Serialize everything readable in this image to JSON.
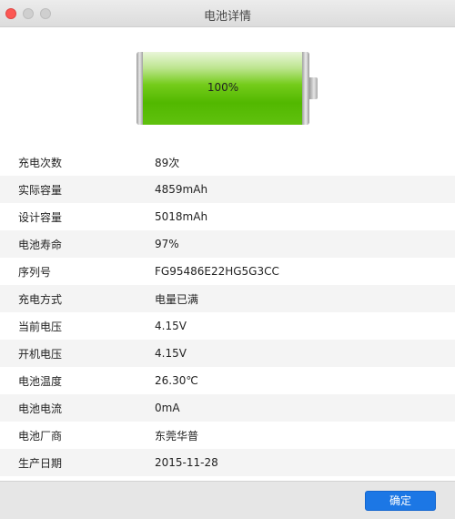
{
  "window": {
    "title": "电池详情"
  },
  "battery": {
    "percent_text": "100%",
    "charge_fraction": 1.0
  },
  "details": [
    {
      "label": "充电次数",
      "value": "89次"
    },
    {
      "label": "实际容量",
      "value": "4859mAh"
    },
    {
      "label": "设计容量",
      "value": "5018mAh"
    },
    {
      "label": "电池寿命",
      "value": "97%"
    },
    {
      "label": "序列号",
      "value": "FG95486E22HG5G3CC"
    },
    {
      "label": "充电方式",
      "value": "电量已满"
    },
    {
      "label": "当前电压",
      "value": "4.15V"
    },
    {
      "label": "开机电压",
      "value": "4.15V"
    },
    {
      "label": "电池温度",
      "value": "26.30℃"
    },
    {
      "label": "电池电流",
      "value": "0mA"
    },
    {
      "label": "电池厂商",
      "value": "东莞华普"
    },
    {
      "label": "生产日期",
      "value": "2015-11-28"
    }
  ],
  "footer": {
    "ok_label": "确定"
  },
  "colors": {
    "accent": "#1c77e5",
    "battery_green": "#52b800",
    "close_red": "#fc5753"
  }
}
